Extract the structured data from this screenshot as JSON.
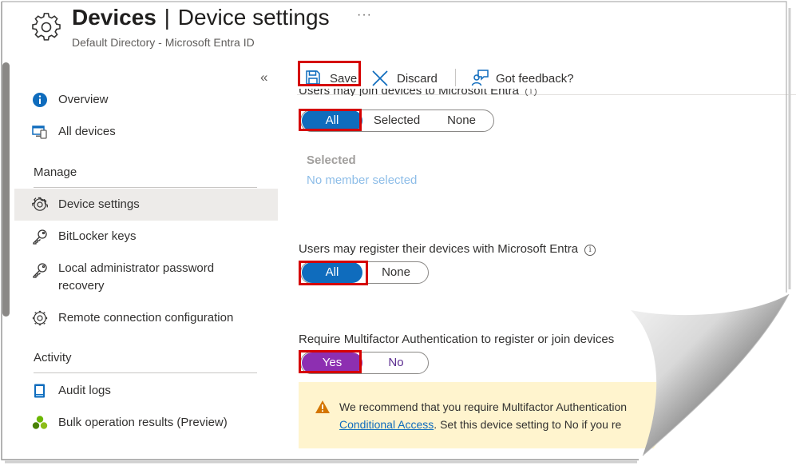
{
  "header": {
    "title_main": "Devices",
    "title_separator": "|",
    "title_sub": "Device settings",
    "more": "···",
    "subtitle": "Default Directory - Microsoft Entra ID",
    "icon": "gear-icon"
  },
  "sidebar": {
    "collapse": "«",
    "items_top": [
      {
        "label": "Overview",
        "icon": "info-icon"
      },
      {
        "label": "All devices",
        "icon": "devices-icon"
      }
    ],
    "section_manage": "Manage",
    "items_manage": [
      {
        "label": "Device settings",
        "icon": "gear-icon",
        "active": true
      },
      {
        "label": "BitLocker keys",
        "icon": "key-icon"
      },
      {
        "label": "Local administrator password recovery",
        "icon": "key-icon"
      },
      {
        "label": "Remote connection configuration",
        "icon": "gear-icon"
      }
    ],
    "section_activity": "Activity",
    "items_activity": [
      {
        "label": "Audit logs",
        "icon": "audit-log-icon"
      },
      {
        "label": "Bulk operation results (Preview)",
        "icon": "bulk-results-icon"
      }
    ]
  },
  "toolbar": {
    "save_label": "Save",
    "discard_label": "Discard",
    "feedback_label": "Got feedback?"
  },
  "settings": {
    "join": {
      "label": "Users may join devices to Microsoft Entra",
      "options": [
        "All",
        "Selected",
        "None"
      ],
      "selected": "All",
      "selected_heading": "Selected",
      "selected_value": "No member selected"
    },
    "register": {
      "label": "Users may register their devices with Microsoft Entra",
      "options": [
        "All",
        "None"
      ],
      "selected": "All"
    },
    "mfa": {
      "label": "Require Multifactor Authentication to register or join devices",
      "options": [
        "Yes",
        "No"
      ],
      "selected": "Yes"
    },
    "warning": {
      "line1": "We recommend that you require Multifactor Authentication",
      "link": "Conditional Access",
      "line2_rest": ". Set this device setting to No if you re"
    }
  },
  "colors": {
    "accent": "#0f6cbd",
    "mfa_selected": "#8d2fb1",
    "highlight_box": "#d50000",
    "warning_bg": "#fff4ce",
    "warning_icon": "#d47500"
  }
}
